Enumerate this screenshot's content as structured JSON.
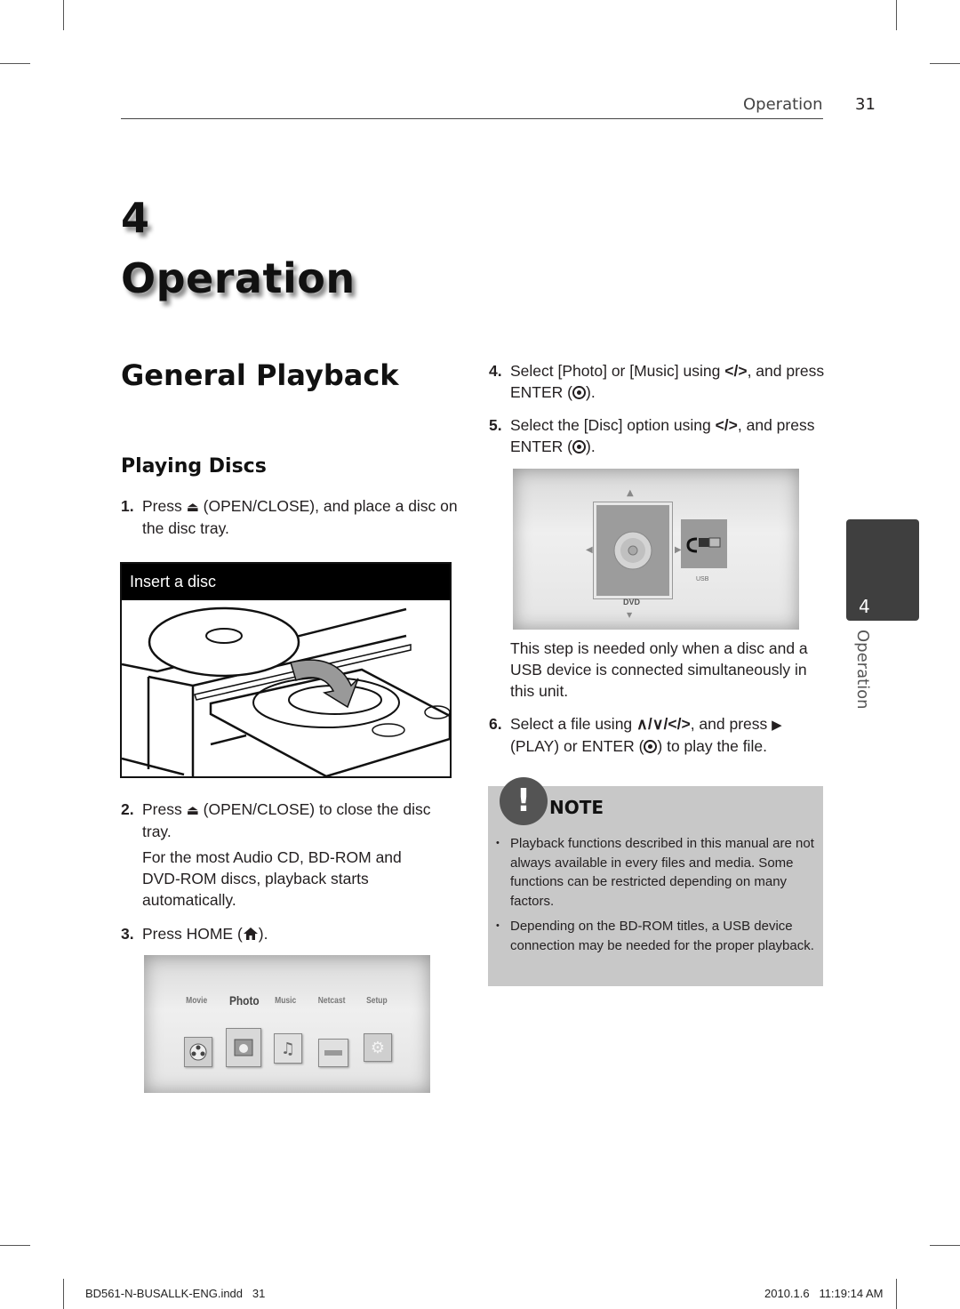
{
  "header": {
    "section": "Operation",
    "page_number": "31"
  },
  "chapter": {
    "number": "4",
    "title": "Operation"
  },
  "heading": "General Playback",
  "subheading": "Playing Discs",
  "steps": {
    "s1": {
      "num": "1.",
      "pre": "Press",
      "icon": "eject-icon",
      "glyph": "⏏",
      "post": "(OPEN/CLOSE), and place a disc on the disc tray."
    },
    "s2": {
      "num": "2.",
      "pre": "Press",
      "icon": "eject-icon",
      "glyph": "⏏",
      "post": "(OPEN/CLOSE) to close the disc tray."
    },
    "s2_note": "For the most Audio CD, BD-ROM and DVD-ROM discs, playback starts automatically.",
    "s3": {
      "num": "3.",
      "pre": "Press HOME (",
      "icon": "home-icon",
      "post": ")."
    },
    "s4": {
      "num": "4.",
      "pre": "Select [Photo] or [Music] using",
      "arrows": "</>",
      "mid": ", and press ENTER (",
      "icon": "enter-icon",
      "post": ")."
    },
    "s5": {
      "num": "5.",
      "pre": "Select the [Disc] option using",
      "arrows": "</>",
      "mid": ", and press ENTER (",
      "icon": "enter-icon",
      "post": ")."
    },
    "s5_note": "This step is needed only when a disc and a USB device is connected simultaneously in this unit.",
    "s6": {
      "num": "6.",
      "pre": "Select a file using",
      "arrows": "∧/∨/</>",
      "mid": ", and press",
      "play_glyph": "▶",
      "mid2": "(PLAY) or ENTER (",
      "icon": "enter-icon",
      "post": ") to play the file."
    }
  },
  "figure_insert": {
    "caption": "Insert a disc"
  },
  "home_menu": {
    "items": [
      "Movie",
      "Photo",
      "Music",
      "Netcast",
      "Setup"
    ],
    "selected": "Photo"
  },
  "disc_menu": {
    "items": [
      "DVD",
      "USB"
    ],
    "selected": "DVD"
  },
  "note": {
    "title": "NOTE",
    "icon_glyph": "!",
    "items": [
      "Playback functions described in this manual are not always available in every files and media. Some functions can be restricted depending on many factors.",
      "Depending on the BD-ROM titles, a USB device connection may be needed for the proper playback."
    ]
  },
  "side_tab": {
    "number": "4",
    "label": "Operation"
  },
  "footer": {
    "file": "BD561-N-BUSALLK-ENG.indd   31",
    "timestamp": "2010.1.6   11:19:14 AM"
  }
}
